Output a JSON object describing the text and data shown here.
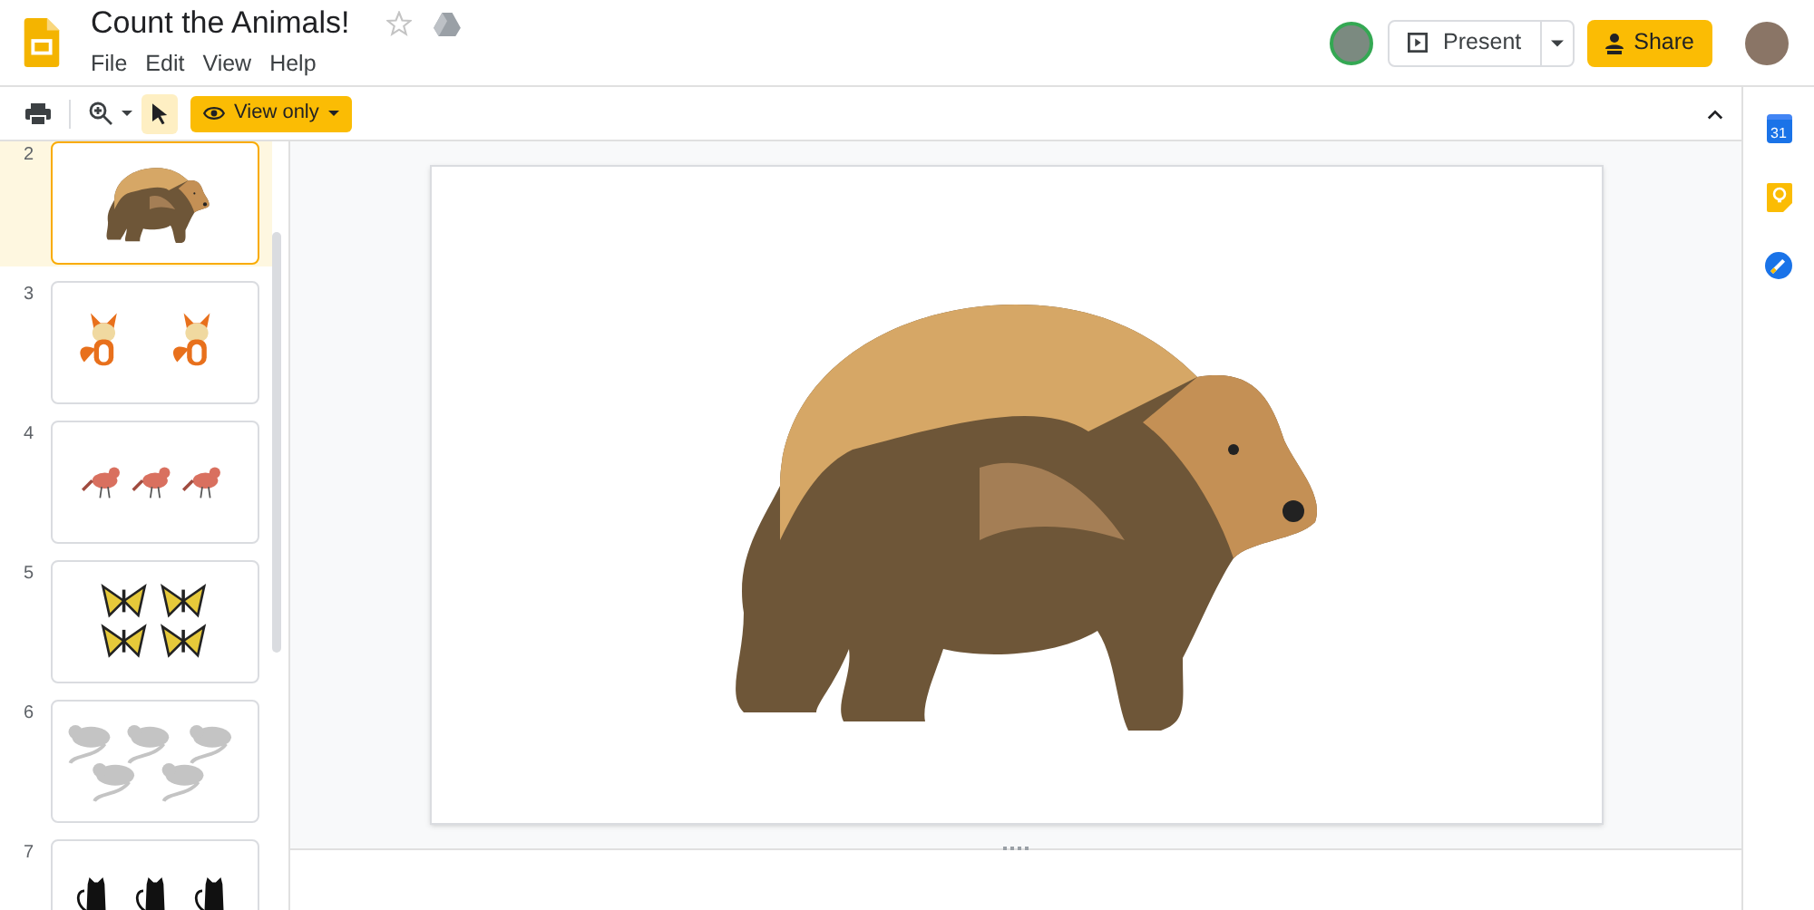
{
  "document": {
    "title": "Count the Animals!",
    "starred": false
  },
  "menu": [
    "File",
    "Edit",
    "View",
    "Help"
  ],
  "header_buttons": {
    "present": "Present",
    "share": "Share"
  },
  "toolbar": {
    "view_mode": "View only",
    "select_tool_active": true
  },
  "slides": [
    {
      "number": "2",
      "kind": "bear",
      "selected": true
    },
    {
      "number": "3",
      "kind": "fox",
      "selected": false
    },
    {
      "number": "4",
      "kind": "bird",
      "selected": false
    },
    {
      "number": "5",
      "kind": "butterfly",
      "selected": false
    },
    {
      "number": "6",
      "kind": "mouse",
      "selected": false
    },
    {
      "number": "7",
      "kind": "cat",
      "selected": false
    }
  ],
  "side_panel": {
    "calendar_day": "31"
  }
}
